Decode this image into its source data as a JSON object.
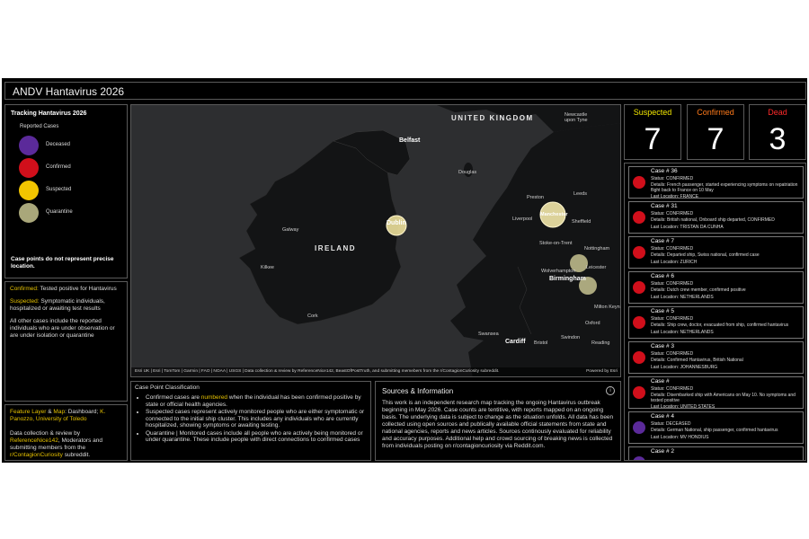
{
  "header": {
    "title": "ANDV Hantavirus 2026"
  },
  "legend": {
    "title": "Tracking Hantavirus 2026",
    "subtitle": "Reported Cases",
    "items": [
      {
        "label": "Deceased",
        "color": "#5b2a9a"
      },
      {
        "label": "Confirmed",
        "color": "#d10f1b"
      },
      {
        "label": "Suspected",
        "color": "#f2c500"
      },
      {
        "label": "Quarantine",
        "color": "#a9a77a"
      }
    ],
    "note": "Case points do not represent precise location."
  },
  "definitions": {
    "confirmed_term": "Confirmed:",
    "confirmed_text": " Tested positive for Hantavirus",
    "suspected_term": "Suspected:",
    "suspected_text": " Symptomatic individuals, hospitalized or awaiting test results",
    "other_text": "All other cases include the reported individuals who are under observation or are under isolation or quarantine"
  },
  "credits": {
    "feature_term": "Feature Layer",
    "amp": " & ",
    "map_term": "Map",
    "dashboard_text": ": Dashboard; ",
    "author": "K. Panozzo, University of Toledo",
    "review_text": "Data collection & review by ",
    "reviewer": "ReferenceNice142",
    "mods_text": ", Moderators and submitting members from the ",
    "subreddit": "r/ContagionCuriosity",
    "end_text": " subreddit."
  },
  "map": {
    "labels": {
      "uk": "UNITED KINGDOM",
      "ireland": "IRELAND",
      "belfast": "Belfast",
      "dublin": "Dublin",
      "galway": "Galway",
      "kilkee": "Kilkee",
      "cork": "Cork",
      "douglas": "Douglas",
      "newcastle": "Newcastle upon Tyne",
      "preston": "Preston",
      "leeds": "Leeds",
      "manchester": "Manchester",
      "liverpool": "Liverpool",
      "sheffield": "Sheffield",
      "stoke": "Stoke-on-Trent",
      "nottingham": "Nottingham",
      "wolverhampton": "Wolverhampton",
      "leicester": "Leicester",
      "birmingham": "Birmingham",
      "milton": "Milton Keyn",
      "oxford": "Oxford",
      "swansea": "Swansea",
      "cardiff": "Cardiff",
      "bristol": "Bristol",
      "swindon": "Swindon",
      "reading": "Reading"
    },
    "attribution": "Esri UK | Esri | TomTom | Garmin | FAO | NOAA | USGS | Data collection & review by ReferenceNice142, BeastOfPostTruth, and submitting memebers from the r/ContagionCuriosity subreddit.",
    "powered": "Powered by Esri"
  },
  "counters": {
    "suspected": {
      "label": "Suspected",
      "value": "7",
      "color": "#f2e600"
    },
    "confirmed": {
      "label": "Confirmed",
      "value": "7",
      "color": "#ff7a1a"
    },
    "dead": {
      "label": "Dead",
      "value": "3",
      "color": "#ff2a2a"
    }
  },
  "cases": [
    {
      "title": "Case # 36",
      "status": "Status: CONFIRMED",
      "details": "Details: French passenger, started experiencing symptoms on repatriation flight back to France on 10 May",
      "location": "Last Location: FRANCE",
      "color": "#d10f1b"
    },
    {
      "title": "Case # 31",
      "status": "Status: CONFIRMED",
      "details": "Details: British national, Onboard ship departed, CONFIRMED",
      "location": "Last Location: TRISTAN DA CUNHA",
      "color": "#d10f1b"
    },
    {
      "title": "Case # 7",
      "status": "Status: CONFIRMED",
      "details": "Details: Departed ship, Swiss national, confirmed case",
      "location": "Last Location: ZURICH",
      "color": "#d10f1b"
    },
    {
      "title": "Case # 6",
      "status": "Status: CONFIRMED",
      "details": "Details: Dutch crew member, confirmed positive",
      "location": "Last Location: NETHERLANDS",
      "color": "#d10f1b"
    },
    {
      "title": "Case # 5",
      "status": "Status: CONFIRMED",
      "details": "Details: Ship crew, doctor, evacuated from ship, confirmed hantavirus",
      "location": "Last Location: NETHERLANDS",
      "color": "#d10f1b"
    },
    {
      "title": "Case # 3",
      "status": "Status: CONFIRMED",
      "details": "Details: Confirmed Hantavirus, British National",
      "location": "Last Location: JOHANNESBURG",
      "color": "#d10f1b"
    },
    {
      "title": "Case #",
      "status": "Status: CONFIRMED",
      "details": "Details: Disembarked ship with Americans on May 10. No symptoms and tested positive",
      "location": "Last Location: UNITED STATES",
      "color": "#d10f1b"
    },
    {
      "title": "Case # 4",
      "status": "Status: DECEASED",
      "details": "Details: German National, ship passenger, confirmed hantavirus",
      "location": "Last Location: MV HONDIUS",
      "color": "#5b2a9a"
    },
    {
      "title": "Case # 2",
      "status": "",
      "details": "",
      "location": "",
      "color": "#5b2a9a"
    }
  ],
  "classification": {
    "heading": "Case Point Classification",
    "b1_pre": "Confirmed cases are ",
    "b1_hl": "numbered",
    "b1_post": " when the individual has been confirmed positive by state or official health agencies.",
    "b2": "Suspected cases represent actively monitored people who are either symptomatic or connected to the initial ship cluster. This includes any individuals who are currently hospitalized, showing symptoms or awaiting testing.",
    "b3": "Quarantine | Monitored cases include all people who are actively being monitored or under quarantine. These include people with direct connections to confirmed cases"
  },
  "sources": {
    "heading": "Sources & Information",
    "body": "This work is an independent research map tracking the ongoing Hantavirus outbreak beginning in May 2026. Case counts are tentitive, with reports mapped on an ongoing basis. The underlying data is subject to change as the situation unfolds. All data has been collected using open sources and publically available official statements from state and national agencies, reports and news articles. Sources continously evaluated for reliability and accuracy purposes. Additional help and crowd sourcing of breaking news is collected from individuals posting on r/contagioncuriosity via Reddit.com."
  }
}
